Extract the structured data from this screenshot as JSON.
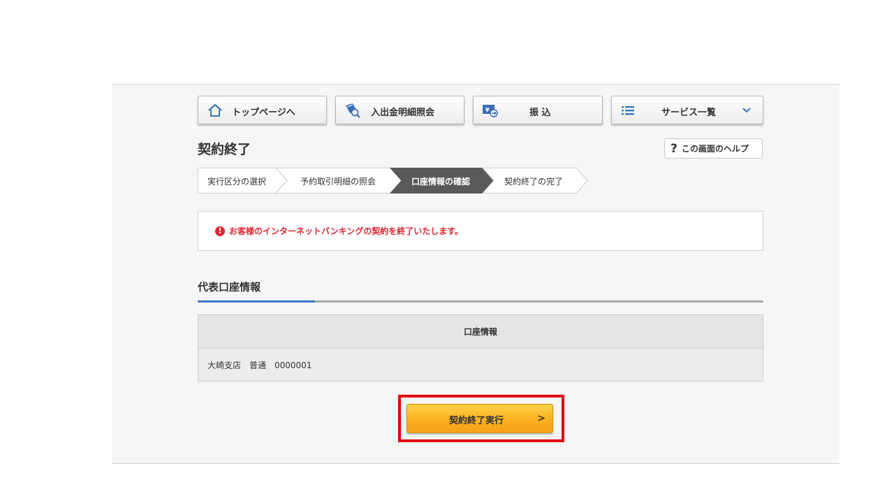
{
  "nav": {
    "top": "トップページへ",
    "statement": "入出金明細照会",
    "transfer": "振 込",
    "services": "サービス一覧"
  },
  "page_title": "契約終了",
  "help_label": "この画面のヘルプ",
  "help_glyph": "?",
  "steps": [
    {
      "label": "実行区分の選択",
      "active": false
    },
    {
      "label": "予約取引明細の照会",
      "active": false
    },
    {
      "label": "口座情報の確認",
      "active": true
    },
    {
      "label": "契約終了の完了",
      "active": false
    }
  ],
  "notice": {
    "icon": "!",
    "text": "お客様のインターネットバンキングの契約を終了いたします。"
  },
  "section_title": "代表口座情報",
  "table": {
    "header": "口座情報",
    "row": "大崎支店　普通　0000001"
  },
  "execute_button": {
    "label": "契約終了実行",
    "chevron": ">"
  },
  "colors": {
    "accent_blue": "#3b77c2",
    "warning_red": "#e02633",
    "highlight_red": "#e60012",
    "button_orange": "#fbb11f",
    "active_step": "#595959"
  }
}
